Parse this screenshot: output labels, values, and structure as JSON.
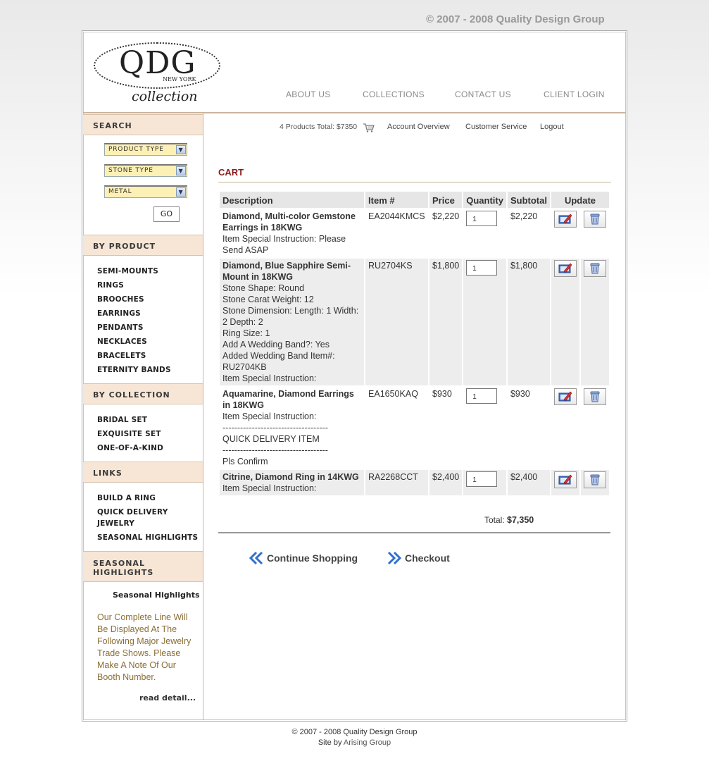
{
  "top_copyright": "© 2007 - 2008 Quality Design Group",
  "logo": {
    "letters": "QDG",
    "subtitle": "NEW YORK",
    "tagline": "collection"
  },
  "nav": [
    "ABOUT US",
    "COLLECTIONS",
    "CONTACT US",
    "CLIENT LOGIN"
  ],
  "sidebar": {
    "search_heading": "SEARCH",
    "selects": [
      "PRODUCT TYPE",
      "STONE TYPE",
      "METAL"
    ],
    "go_label": "GO",
    "by_product_heading": "BY PRODUCT",
    "by_product": [
      "SEMI-MOUNTS",
      "RINGS",
      "BROOCHES",
      "EARRINGS",
      "PENDANTS",
      "NECKLACES",
      "BRACELETS",
      "ETERNITY BANDS"
    ],
    "by_collection_heading": "BY COLLECTION",
    "by_collection": [
      "BRIDAL SET",
      "EXQUISITE SET",
      "ONE-OF-A-KIND"
    ],
    "links_heading": "LINKS",
    "links": [
      "BUILD A RING",
      "QUICK DELIVERY JEWELRY",
      "SEASONAL HIGHLIGHTS"
    ],
    "seasonal_heading": "SEASONAL HIGHLIGHTS",
    "seasonal_title": "Seasonal Highlights",
    "seasonal_text": "Our Complete Line Will Be Displayed At The Following Major Jewelry Trade Shows. Please Make A Note Of Our Booth Number.",
    "read_more": "read detail..."
  },
  "toplinks": {
    "products_total": "4 Products Total: $7350",
    "account": "Account Overview",
    "service": "Customer Service",
    "logout": "Logout"
  },
  "cart": {
    "title": "CART",
    "headers": [
      "Description",
      "Item #",
      "Price",
      "Quantity",
      "Subtotal",
      "Update"
    ],
    "rows": [
      {
        "name": "Diamond, Multi-color Gemstone Earrings in 18KWG",
        "details": [
          "Item Special Instruction: Please Send ASAP"
        ],
        "item": "EA2044KMCS",
        "price": "$2,220",
        "qty": "1",
        "subtotal": "$2,220"
      },
      {
        "name": "Diamond, Blue Sapphire Semi-Mount in 18KWG",
        "details": [
          "Stone Shape: Round",
          "Stone Carat Weight: 12",
          "Stone Dimension: Length: 1 Width: 2 Depth: 2",
          "Ring Size: 1",
          "Add A Wedding Band?: Yes",
          "Added Wedding Band Item#: RU2704KB",
          "Item Special Instruction:"
        ],
        "item": "RU2704KS",
        "price": "$1,800",
        "qty": "1",
        "subtotal": "$1,800"
      },
      {
        "name": "Aquamarine, Diamond Earrings in 18KWG",
        "details": [
          "Item Special Instruction:",
          "------------------------------------",
          "QUICK DELIVERY ITEM",
          "------------------------------------",
          "Pls Confirm"
        ],
        "item": "EA1650KAQ",
        "price": "$930",
        "qty": "1",
        "subtotal": "$930"
      },
      {
        "name": "Citrine, Diamond Ring in 14KWG",
        "details": [
          "Item Special Instruction:"
        ],
        "item": "RA2268CCT",
        "price": "$2,400",
        "qty": "1",
        "subtotal": "$2,400"
      }
    ],
    "total_label": "Total:",
    "total_value": "$7,350"
  },
  "actions": {
    "continue": "Continue Shopping",
    "checkout": "Checkout"
  },
  "footer": {
    "line1": "© 2007 - 2008 Quality Design Group",
    "line2_prefix": "Site by",
    "line2_link": "Arising Group"
  }
}
